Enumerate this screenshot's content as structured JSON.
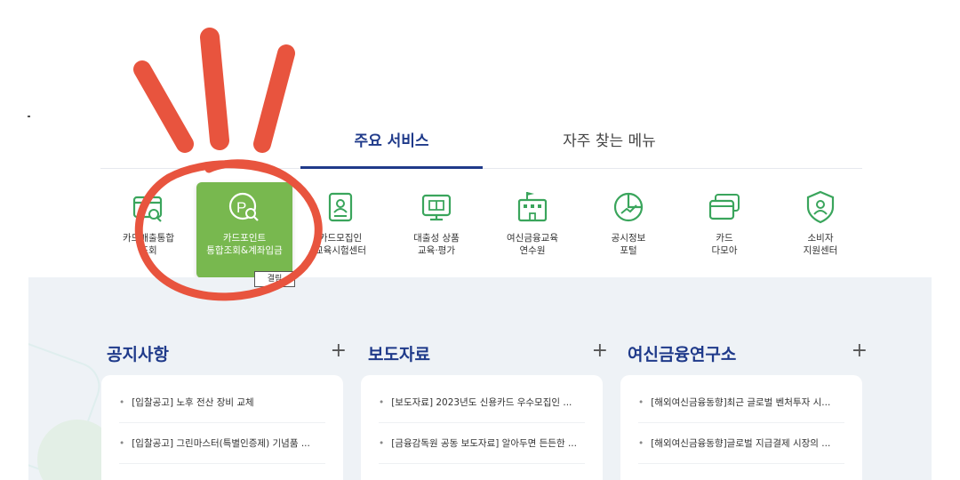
{
  "tabs": [
    {
      "label": "주요 서비스",
      "active": true
    },
    {
      "label": "자주 찾는 메뉴",
      "active": false
    }
  ],
  "services": [
    {
      "label": "카드매출통합\n조회",
      "icon": "card-search-icon"
    },
    {
      "label": "카드포인트\n통합조회&계좌입금",
      "icon": "point-search-icon",
      "active": true
    },
    {
      "label": "카드모집인\n교육시험센터",
      "icon": "recruiter-icon"
    },
    {
      "label": "대출성 상품\n교육·평가",
      "icon": "monitor-book-icon"
    },
    {
      "label": "여신금융교육\n연수원",
      "icon": "school-building-icon"
    },
    {
      "label": "공시정보\n포털",
      "icon": "pie-chart-icon"
    },
    {
      "label": "카드\n다모아",
      "icon": "cards-icon"
    },
    {
      "label": "소비자\n지원센터",
      "icon": "shield-user-icon"
    }
  ],
  "active_badge": "결림",
  "columns": [
    {
      "title": "공지사항",
      "items": [
        "[입찰공고] 노후 전산 장비 교체",
        "[입찰공고] 그린마스터(특별인증제) 기념품 ..."
      ]
    },
    {
      "title": "보도자료",
      "items": [
        "[보도자료] 2023년도 신용카드 우수모집인 ...",
        "[금융감독원 공동 보도자료] 알아두면 든든한 ..."
      ]
    },
    {
      "title": "여신금융연구소",
      "items": [
        "[해외여신금융동향]최근 글로벌 벤처투자 시...",
        "[해외여신금융동향]글로벌 지급결제 시장의 ..."
      ]
    }
  ],
  "plus_symbol": "+",
  "colors": {
    "brand_blue": "#1f3a8a",
    "active_green": "#78b84f",
    "highlight_red": "#e8543e",
    "background": "#eef2f6"
  }
}
